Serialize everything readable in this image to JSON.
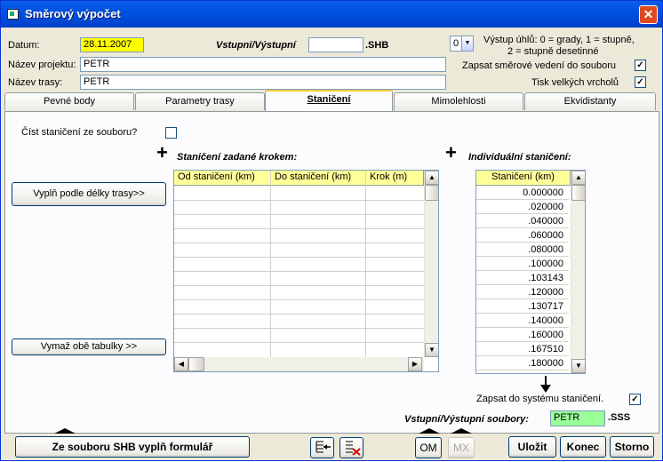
{
  "window": {
    "title": "Směrový výpočet",
    "close_glyph": "✕"
  },
  "header": {
    "date_label": "Datum:",
    "date_value": "28.11.2007",
    "io_label": "Vstupní/Výstupní",
    "shb_value": "",
    "shb_ext": ".SHB",
    "project_label": "Název projektu:",
    "project_value": "PETR",
    "route_label": "Název trasy:",
    "route_value": "PETR",
    "angle_combo_value": "0",
    "angle_combo_arrow": "▼",
    "angle_note_line1": "Výstup úhlů: 0 = grady, 1 =  stupně,",
    "angle_note_line2": "2 = stupně desetinné",
    "write_direction_label": "Zapsat směrové vedení do souboru",
    "write_direction_checked": "✓",
    "print_vertices_label": "Tisk velkých vrcholů",
    "print_vertices_checked": "✓"
  },
  "tabs": [
    "Pevné body",
    "Parametry trasy",
    "Staničení",
    "Mimolehlosti",
    "Ekvidistanty"
  ],
  "active_tab": "Staničení",
  "stationing": {
    "read_file_label": "Číst staničení ze souboru?",
    "read_file_checked": "",
    "plus_glyph": "+",
    "step_title": "Staničení zadané krokem:",
    "individual_title": "Individuální staničení:",
    "fill_button": "Vyplň podle délky trasy>>",
    "clear_button": "Vymaž obě tabulky >>",
    "step_columns": [
      "Od staničení (km)",
      "Do staničení (km)",
      "Krok  (m)"
    ],
    "individual_column": "Staničení (km)",
    "individual_values": [
      "0.000000",
      ".020000",
      ".040000",
      ".060000",
      ".080000",
      ".100000",
      ".103143",
      ".120000",
      ".130717",
      ".140000",
      ".160000",
      ".167510",
      ".180000"
    ],
    "write_system_label": "Zapsat do systému staničení.",
    "write_system_checked": "✓",
    "io_files_label": "Vstupní/Výstupní soubory:",
    "io_files_value": "PETR",
    "io_files_ext": ".SSS"
  },
  "scroll": {
    "up": "▲",
    "down": "▼",
    "left": "◀",
    "right": "▶"
  },
  "bottom": {
    "fill_from_shb": "Ze souboru SHB vyplň formulář",
    "om": "OM",
    "mx": "MX",
    "save": "Uložit",
    "end": "Konec",
    "cancel": "Storno"
  }
}
